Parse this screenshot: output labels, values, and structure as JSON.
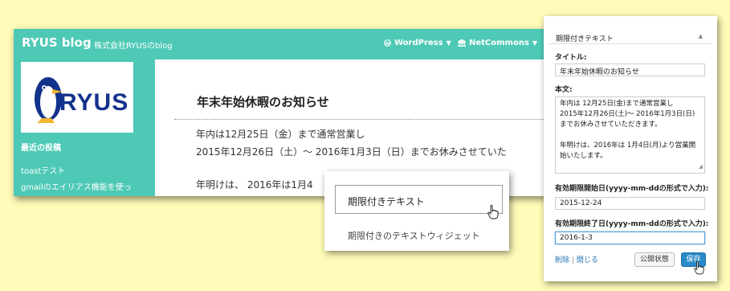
{
  "blog": {
    "title": "RYUS blog",
    "tagline": "株式会社RYUSのblog",
    "nav": [
      {
        "label": "WordPress",
        "icon": "wordpress-icon"
      },
      {
        "label": "NetCommons",
        "icon": "building-icon"
      }
    ],
    "logo_text": "RYUS",
    "sidebar_heading": "最近の投稿",
    "sidebar_links": [
      "toastテスト",
      "gmailのエイリアス機能を使っ"
    ],
    "post": {
      "title": "年末年始休暇のお知らせ",
      "lines": [
        "年内は12月25日（金）まで通常営業し",
        "2015年12月26日（土）～ 2016年1月3日（日）までお休みさせていた",
        "年明けは、 2016年は1月4"
      ]
    }
  },
  "popup": {
    "item_label": "期限付きテキスト",
    "item_description": "期限付きのテキストウィジェット"
  },
  "panel": {
    "header": "期限付きテキスト",
    "title_label": "タイトル:",
    "title_value": "年末年始休暇のお知らせ",
    "body_label": "本文:",
    "body_lines": [
      "年内は 12月25日(金)まで通常営業し",
      "2015年12月26日(土)～ 2016年1月3日(日)",
      "までお休みさせていただきます。",
      "",
      "年明けは、2016年は 1月4日(月)より営業開",
      "始いたします。"
    ],
    "start_label": "有効期限開始日(yyyy-mm-ddの形式で入力):",
    "start_value": "2015-12-24",
    "end_label": "有効期限終了日(yyyy-mm-ddの形式で入力):",
    "end_value": "2016-1-3",
    "delete_link": "削除",
    "close_link": "閉じる",
    "publish_state_button": "公開状態",
    "save_button": "保存"
  },
  "colors": {
    "background": "#fffbb8",
    "header_teal": "#4ec9b5",
    "logo_blue": "#13328c",
    "primary_button": "#2a8bc8"
  }
}
